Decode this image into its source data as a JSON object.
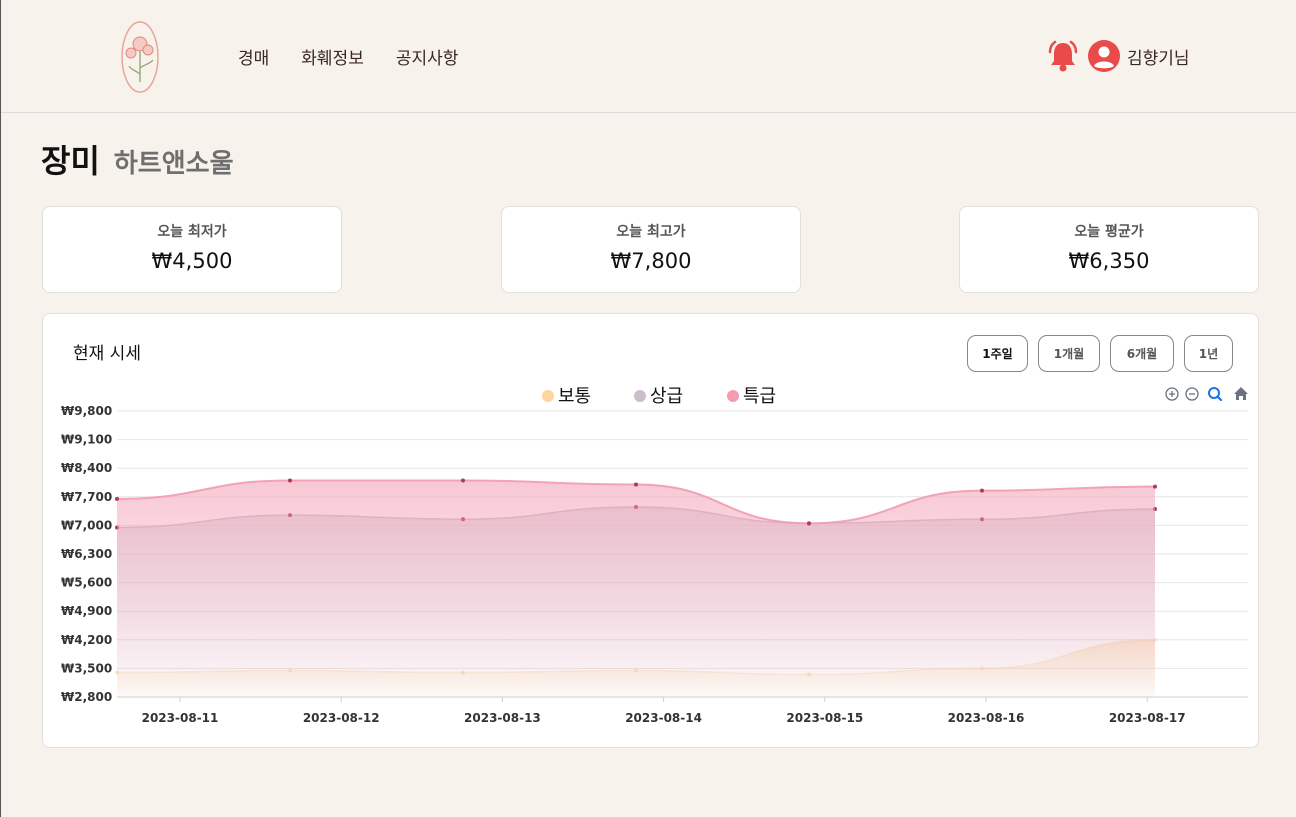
{
  "nav": {
    "items": [
      "경매",
      "화훼정보",
      "공지사항"
    ]
  },
  "user": {
    "name": "김향기님"
  },
  "product": {
    "name": "장미",
    "variety": "하트앤소울"
  },
  "stats": [
    {
      "label": "오늘 최저가",
      "value": "₩4,500"
    },
    {
      "label": "오늘 최고가",
      "value": "₩7,800"
    },
    {
      "label": "오늘 평균가",
      "value": "₩6,350"
    }
  ],
  "chart_panel": {
    "title": "현재 시세",
    "periods": [
      "1주일",
      "1개월",
      "6개월",
      "1년"
    ],
    "active_period": "1주일"
  },
  "colors": {
    "accent": "#e94b4b",
    "normal": "#fcd5a0",
    "premium": "#cbbfcc",
    "special": "#f29bb1"
  },
  "chart_data": {
    "type": "area",
    "x": [
      "2023-08-11",
      "2023-08-12",
      "2023-08-13",
      "2023-08-14",
      "2023-08-15",
      "2023-08-16",
      "2023-08-17"
    ],
    "series": [
      {
        "name": "보통",
        "color": "#fcd5a0",
        "values": [
          3400,
          3450,
          3400,
          3450,
          3350,
          3500,
          4200
        ]
      },
      {
        "name": "상급",
        "color": "#cbbfcc",
        "values": [
          6950,
          7250,
          7150,
          7450,
          7050,
          7150,
          7400
        ]
      },
      {
        "name": "특급",
        "color": "#f29bb1",
        "values": [
          7650,
          8100,
          8100,
          8000,
          7050,
          7850,
          7950
        ]
      }
    ],
    "ylim": [
      2800,
      9800
    ],
    "yticks": [
      "₩9,800",
      "₩9,100",
      "₩8,400",
      "₩7,700",
      "₩7,000",
      "₩6,300",
      "₩5,600",
      "₩4,900",
      "₩4,200",
      "₩3,500",
      "₩2,800"
    ],
    "legend": "top-center",
    "grid": true
  },
  "icons": [
    "bell-icon",
    "user-icon",
    "zoom-in-icon",
    "zoom-out-icon",
    "zoom-select-icon",
    "home-icon"
  ]
}
